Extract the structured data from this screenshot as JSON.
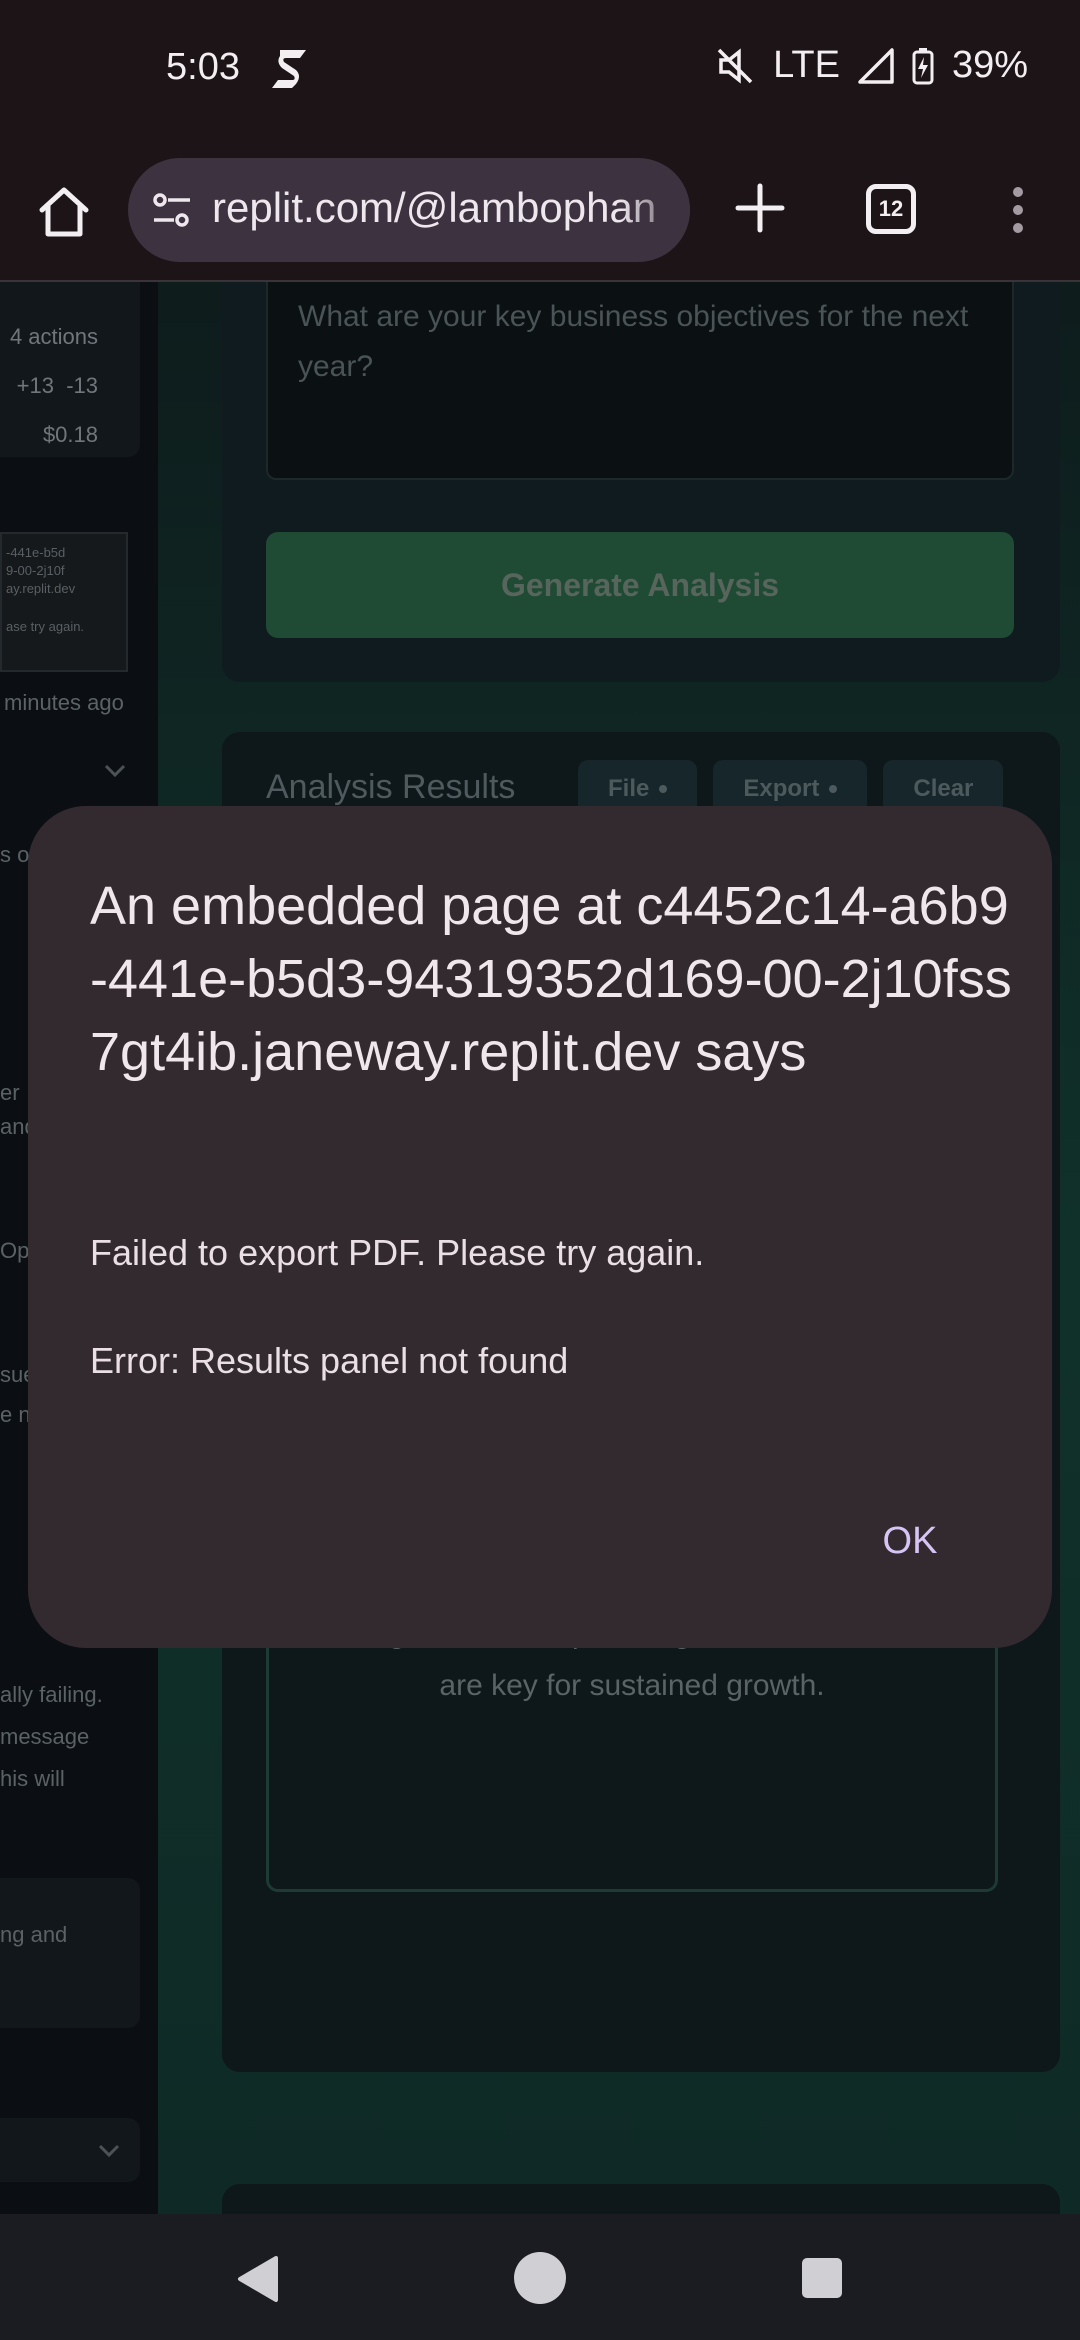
{
  "status_bar": {
    "time": "5:03",
    "network": "LTE",
    "battery": "39%",
    "icons": [
      "app-s-icon",
      "mute-icon",
      "signal-icon",
      "battery-charging-icon"
    ]
  },
  "toolbar": {
    "url": "replit.com/@lambophan",
    "tab_count": "12",
    "icons": [
      "home-icon",
      "tune-icon",
      "plus-icon",
      "tabs-icon",
      "more-vert-icon"
    ]
  },
  "background_page": {
    "left_panel": {
      "actions": "4 actions",
      "diff_add": "+13",
      "diff_remove": "-13",
      "cost": "$0.18",
      "thumb_lines": [
        "-441e-b5d",
        "9-00-2j10f",
        "ay.replit.dev",
        "",
        "",
        "ase try again."
      ],
      "time_ago": "minutes ago",
      "fragments": [
        "s o",
        "er",
        "and",
        "Op",
        "sue",
        "e n",
        "ally failing.",
        "message",
        "his will",
        "ng and"
      ]
    },
    "textarea_placeholder": "What are your key business objectives for the next year?",
    "generate_label": "Generate Analysis",
    "results_title": "Analysis Results",
    "results_buttons": [
      "File",
      "Export",
      "Clear"
    ],
    "analysis_text": "management and optimizing resource allocation are key for sustained growth."
  },
  "dialog": {
    "title": "An embedded page at c4452c14-a6b9-441e-b5d3-94319352d169-00-2j10fss7gt4ib.janeway.replit.dev says",
    "message_line1": "Failed to export PDF. Please try again.",
    "message_line2": "Error: Results panel not found",
    "ok_label": "OK"
  },
  "nav_bar": {
    "icons": [
      "back-icon",
      "home-circle-icon",
      "recents-icon"
    ]
  }
}
